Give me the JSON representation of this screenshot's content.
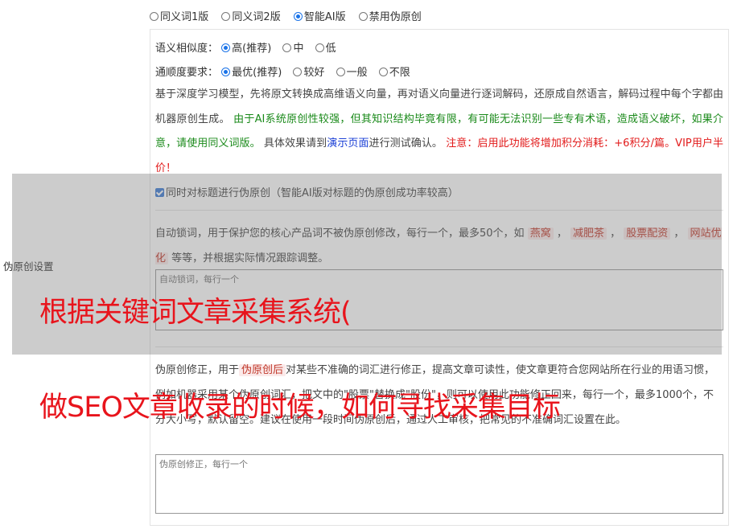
{
  "mode_options": [
    {
      "label": "同义词1版",
      "selected": false
    },
    {
      "label": "同义词2版",
      "selected": false
    },
    {
      "label": "智能AI版",
      "selected": true
    },
    {
      "label": "禁用伪原创",
      "selected": false
    }
  ],
  "similarity": {
    "label": "语义相似度：",
    "options": [
      {
        "label": "高(推荐)",
        "selected": true
      },
      {
        "label": "中",
        "selected": false
      },
      {
        "label": "低",
        "selected": false
      }
    ]
  },
  "fluency": {
    "label": "通顺度要求：",
    "options": [
      {
        "label": "最优(推荐)",
        "selected": true
      },
      {
        "label": "较好",
        "selected": false
      },
      {
        "label": "一般",
        "selected": false
      },
      {
        "label": "不限",
        "selected": false
      }
    ]
  },
  "description": {
    "intro": "基于深度学习模型，先将原文转换成高维语义向量，再对语义向量进行逐词解码，还原成自然语言，解码过程中每个字都由机器原创生成。",
    "warning_green": "由于AI系统原创性较强，但其知识结构毕竟有限，有可能无法识别一些专有术语，造成语义破坏，如果介意，请使用同义词版。",
    "effect_prefix": "具体效果请到",
    "demo_link": "演示页面",
    "effect_suffix": "进行测试确认。",
    "cost_note": "注意：启用此功能将增加积分消耗：+6积分/篇。VIP用户半价！"
  },
  "title_checkbox": {
    "label": "同时对标题进行伪原创（智能AI版对标题的伪原创成功率较高）",
    "checked": true
  },
  "side_label": "伪原创设置",
  "lock_words": {
    "desc_prefix": "自动锁词，用于保护您的核心产品词不被伪原创修改，每行一个，最多50个，如",
    "tags": [
      "燕窝",
      "减肥茶",
      "股票配资",
      "网站优化"
    ],
    "desc_suffix": "等等，并根据实际情况跟踪调整。",
    "placeholder": "自动锁词，每行一个"
  },
  "fix_words": {
    "desc_prefix": "伪原创修正，用于",
    "tag": "伪原创后",
    "desc_suffix": "对某些不准确的词汇进行修正，提高文章可读性，使文章更符合您网站所在行业的用语习惯，例如机器采用某个伪原创词汇，把文中的\"股票\"替换成\"股份\"，则可以使用此功能修正回来，每行一个，最多1000个，不分大小写，默认留空。建议在使用一段时间伪原创后，通过人工审核，把常见的不准确词汇设置在此。",
    "placeholder": "伪原创修正，每行一个"
  },
  "overlay": {
    "line1": "根据关键词文章采集系统(",
    "line2": "做SEO文章收录的时候，如何寻找采集目标"
  }
}
